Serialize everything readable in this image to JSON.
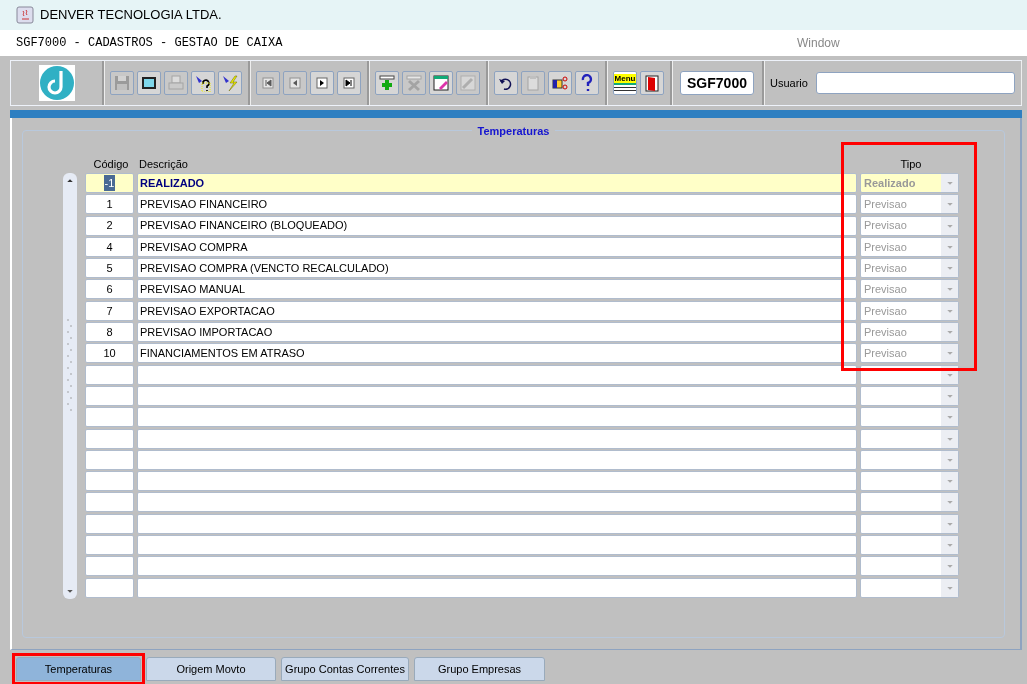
{
  "window": {
    "title": "DENVER TECNOLOGIA LTDA."
  },
  "form_title": "SGF7000 - CADASTROS - GESTAO DE CAIXA",
  "menu": [
    "Window"
  ],
  "toolbar": {
    "groups": [
      [
        {
          "kind": "save",
          "disabled": true
        },
        {
          "kind": "window",
          "disabled": false
        },
        {
          "kind": "print",
          "disabled": true
        },
        {
          "kind": "query",
          "disabled": false
        },
        {
          "kind": "execute",
          "disabled": false
        }
      ],
      [
        {
          "kind": "first",
          "disabled": true
        },
        {
          "kind": "prev",
          "disabled": true
        },
        {
          "kind": "next",
          "disabled": false
        },
        {
          "kind": "last",
          "disabled": false
        }
      ],
      [
        {
          "kind": "insert",
          "disabled": false
        },
        {
          "kind": "delete",
          "disabled": true
        },
        {
          "kind": "edit",
          "disabled": false
        },
        {
          "kind": "tool",
          "disabled": true
        }
      ],
      [
        {
          "kind": "undo",
          "disabled": false
        },
        {
          "kind": "paste",
          "disabled": true
        },
        {
          "kind": "cut",
          "disabled": false
        },
        {
          "kind": "help",
          "disabled": false
        }
      ],
      [
        {
          "kind": "menu",
          "disabled": false,
          "text": "Menu"
        },
        {
          "kind": "exit",
          "disabled": false
        }
      ]
    ],
    "form_code": "SGF7000",
    "user_label": "Usuario"
  },
  "block": {
    "title": "Temperaturas",
    "columns": [
      {
        "label": "Código",
        "highlighted": false
      },
      {
        "label": "Descrição",
        "highlighted": false
      },
      {
        "label": "Tipo",
        "highlighted": true
      }
    ],
    "rows": [
      {
        "codigo": "-1",
        "descricao": "REALIZADO",
        "tipo": "Realizado",
        "selected": true
      },
      {
        "codigo": "1",
        "descricao": "PREVISAO FINANCEIRO",
        "tipo": "Previsao",
        "selected": false
      },
      {
        "codigo": "2",
        "descricao": "PREVISAO FINANCEIRO (BLOQUEADO)",
        "tipo": "Previsao",
        "selected": false
      },
      {
        "codigo": "4",
        "descricao": "PREVISAO COMPRA",
        "tipo": "Previsao",
        "selected": false
      },
      {
        "codigo": "5",
        "descricao": "PREVISAO COMPRA (VENCTO RECALCULADO)",
        "tipo": "Previsao",
        "selected": false
      },
      {
        "codigo": "6",
        "descricao": "PREVISAO MANUAL",
        "tipo": "Previsao",
        "selected": false
      },
      {
        "codigo": "7",
        "descricao": "PREVISAO EXPORTACAO",
        "tipo": "Previsao",
        "selected": false
      },
      {
        "codigo": "8",
        "descricao": "PREVISAO IMPORTACAO",
        "tipo": "Previsao",
        "selected": false
      },
      {
        "codigo": "10",
        "descricao": "FINANCIAMENTOS EM ATRASO",
        "tipo": "Previsao",
        "selected": false
      }
    ]
  },
  "tabs": [
    {
      "label": "Temperaturas",
      "selected": true,
      "highlighted": true
    },
    {
      "label": "Origem Movto",
      "selected": false,
      "highlighted": false
    },
    {
      "label": "Grupo Contas Correntes",
      "selected": false,
      "highlighted": false
    },
    {
      "label": "Grupo Empresas",
      "selected": false,
      "highlighted": false
    }
  ]
}
